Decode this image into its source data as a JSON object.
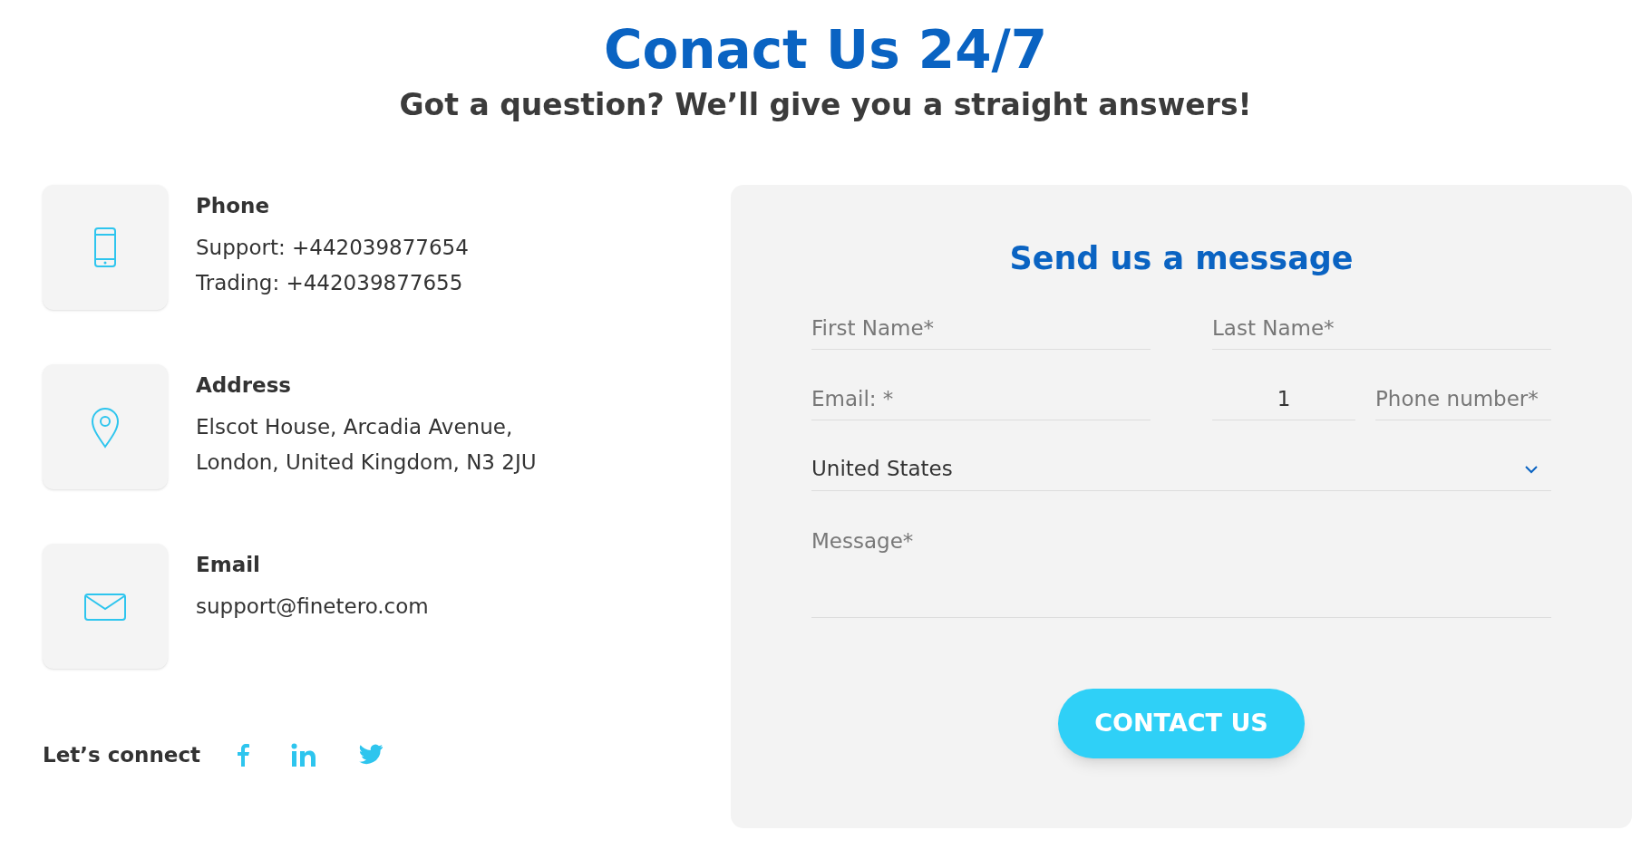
{
  "heading": "Conact Us 24/7",
  "subheading": "Got a question? We’ll give you a straight answers!",
  "contacts": [
    {
      "kind": "phone",
      "title": "Phone",
      "lines": [
        "Support: +442039877654",
        "Trading: +442039877655"
      ]
    },
    {
      "kind": "address",
      "title": "Address",
      "lines": [
        "Elscot House, Arcadia Avenue,",
        "London, United Kingdom, N3 2JU"
      ]
    },
    {
      "kind": "email",
      "title": "Email",
      "lines": [
        "support@finetero.com"
      ]
    }
  ],
  "social": {
    "label": "Let’s connect",
    "links": [
      {
        "kind": "facebook"
      },
      {
        "kind": "linkedin"
      },
      {
        "kind": "twitter"
      }
    ]
  },
  "form": {
    "title": "Send us a message",
    "first_name": {
      "placeholder": "First Name*"
    },
    "last_name": {
      "placeholder": "Last Name*"
    },
    "email": {
      "placeholder": "Email: *"
    },
    "phone_code": {
      "value": "1"
    },
    "phone": {
      "placeholder": "Phone number*"
    },
    "country": {
      "value": "United States"
    },
    "message": {
      "placeholder": "Message*"
    },
    "button": "CONTACT US"
  }
}
